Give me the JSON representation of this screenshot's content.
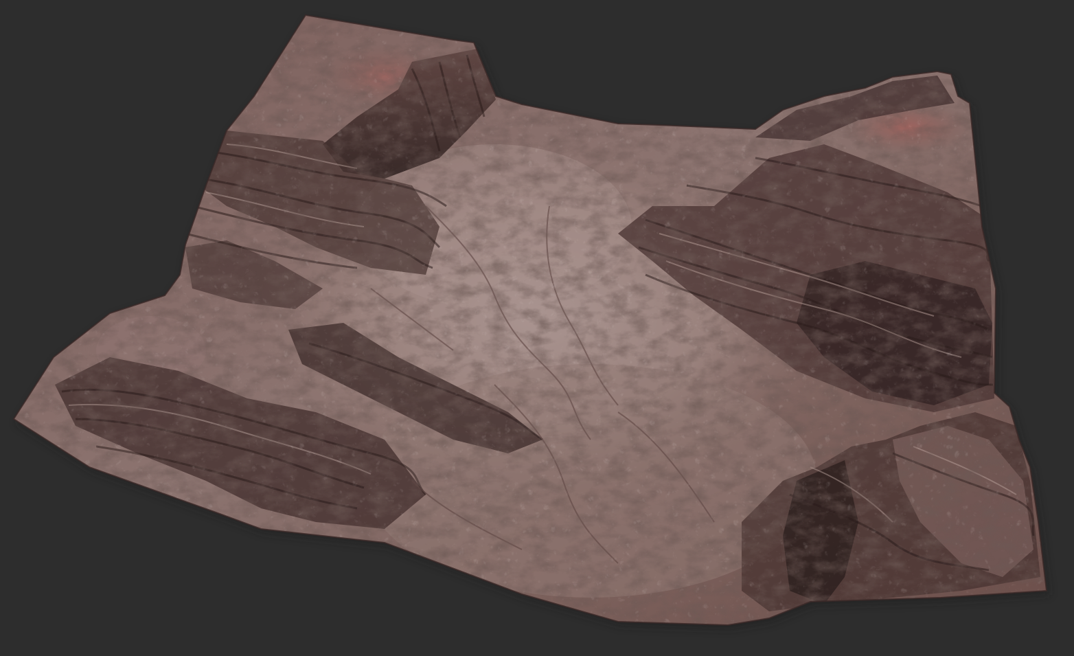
{
  "scene": {
    "background_color": "#2d2d2d",
    "subject": "terrain-mesh",
    "palette": {
      "rock_base": "#7a5a56",
      "rock_light": "#a88a82",
      "rock_pale": "#b8a29b",
      "rock_dark": "#3e2c2b",
      "rock_shadow": "#241a1a",
      "rock_red": "#8f5a52",
      "plateau_red": "#9a6460"
    }
  }
}
